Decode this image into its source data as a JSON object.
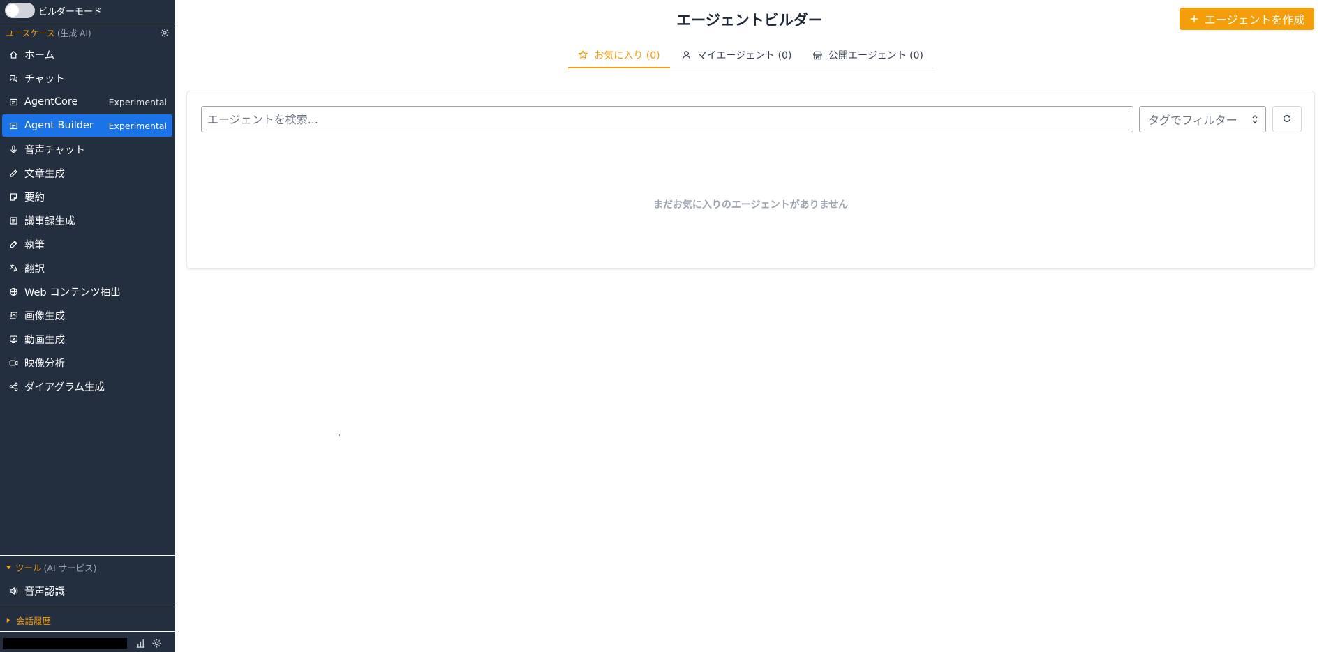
{
  "builder_mode": {
    "label": "ビルダーモード",
    "enabled": false
  },
  "usecases": {
    "title": "ユースケース",
    "subtitle": "(生成 AI)",
    "items": [
      {
        "label": "ホーム",
        "icon": "home-icon",
        "badge": ""
      },
      {
        "label": "チャット",
        "icon": "chat-icon",
        "badge": ""
      },
      {
        "label": "AgentCore",
        "icon": "agent-icon",
        "badge": "Experimental"
      },
      {
        "label": "Agent Builder",
        "icon": "agent-icon",
        "badge": "Experimental",
        "active": true
      },
      {
        "label": "音声チャット",
        "icon": "microphone-icon",
        "badge": ""
      },
      {
        "label": "文章生成",
        "icon": "pencil-icon",
        "badge": ""
      },
      {
        "label": "要約",
        "icon": "note-icon",
        "badge": ""
      },
      {
        "label": "議事録生成",
        "icon": "document-icon",
        "badge": ""
      },
      {
        "label": "執筆",
        "icon": "pen-icon",
        "badge": ""
      },
      {
        "label": "翻訳",
        "icon": "translate-icon",
        "badge": ""
      },
      {
        "label": "Web コンテンツ抽出",
        "icon": "globe-icon",
        "badge": ""
      },
      {
        "label": "画像生成",
        "icon": "images-icon",
        "badge": ""
      },
      {
        "label": "動画生成",
        "icon": "video-generate-icon",
        "badge": ""
      },
      {
        "label": "映像分析",
        "icon": "camera-icon",
        "badge": ""
      },
      {
        "label": "ダイアグラム生成",
        "icon": "diagram-icon",
        "badge": ""
      }
    ]
  },
  "tools": {
    "title": "ツール",
    "subtitle": "(AI サービス)",
    "items": [
      {
        "label": "音声認識",
        "icon": "speaker-icon"
      }
    ]
  },
  "history": {
    "title": "会話履歴"
  },
  "main": {
    "title": "エージェントビルダー",
    "create_button": "エージェントを作成",
    "tabs": [
      {
        "label": "お気に入り (0)",
        "icon": "star-icon",
        "active": true
      },
      {
        "label": "マイエージェント (0)",
        "icon": "user-icon",
        "active": false
      },
      {
        "label": "公開エージェント (0)",
        "icon": "store-icon",
        "active": false
      }
    ],
    "search": {
      "placeholder": "エージェントを検索...",
      "value": ""
    },
    "tag_filter": {
      "selected": "タグでフィルター"
    },
    "empty_message": "まだお気に入りのエージェントがありません"
  },
  "colors": {
    "sidebar_bg": "#232f3e",
    "accent": "#f59e0b",
    "active_nav": "#1a73e8"
  }
}
